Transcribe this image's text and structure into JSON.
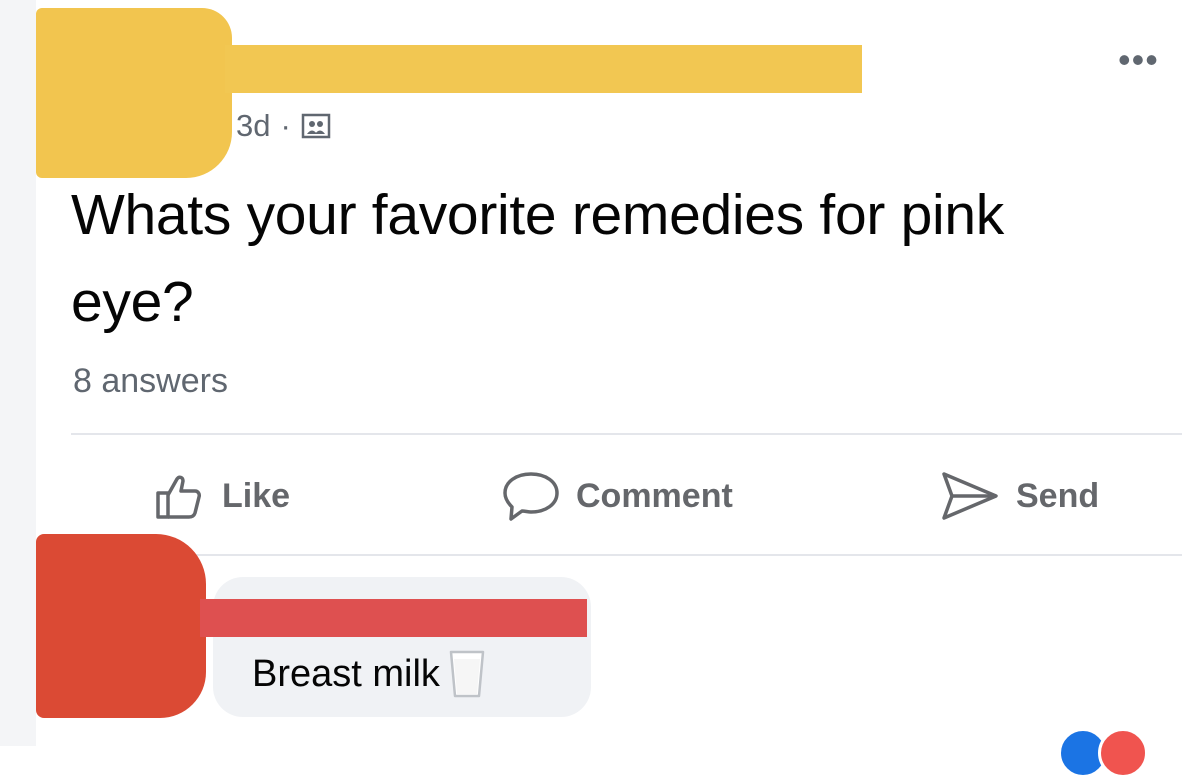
{
  "post": {
    "time": "3d",
    "separator": "·",
    "audience_icon": "group-icon",
    "text": "Whats your favorite remedies for pink eye?",
    "answers_count": "8 answers",
    "more_icon": "•••"
  },
  "actions": {
    "like_label": "Like",
    "comment_label": "Comment",
    "send_label": "Send"
  },
  "comment": {
    "text": "Breast milk",
    "emoji_icon": "milk-glass-icon"
  },
  "colors": {
    "redaction_yellow": "#f2c54f",
    "redaction_red": "#db4a34",
    "secondary_text": "#606770",
    "bubble_bg": "#f0f2f5"
  }
}
